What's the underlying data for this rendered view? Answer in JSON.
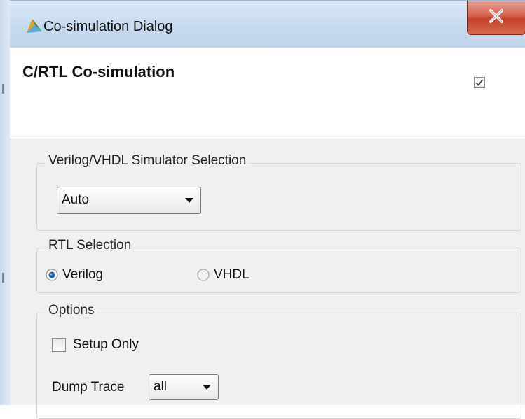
{
  "window": {
    "title": "Co-simulation Dialog",
    "app_icon": "vivado-hls-icon",
    "close_icon": "close-icon"
  },
  "header": {
    "title": "C/RTL Co-simulation",
    "check_icon": "checkmark-icon"
  },
  "simulator_group": {
    "legend": "Verilog/VHDL Simulator Selection",
    "selected": "Auto"
  },
  "rtl_group": {
    "legend": "RTL Selection",
    "options": [
      {
        "label": "Verilog",
        "selected": true
      },
      {
        "label": "VHDL",
        "selected": false
      }
    ]
  },
  "options_group": {
    "legend": "Options",
    "setup_only": {
      "label": "Setup Only",
      "checked": false
    },
    "dump_trace": {
      "label": "Dump Trace",
      "selected": "all"
    }
  },
  "colors": {
    "titlebar": "#c7daef",
    "close_button": "#c4402a",
    "radio_selected": "#1d5fa8",
    "panel": "#f0f0f0"
  }
}
